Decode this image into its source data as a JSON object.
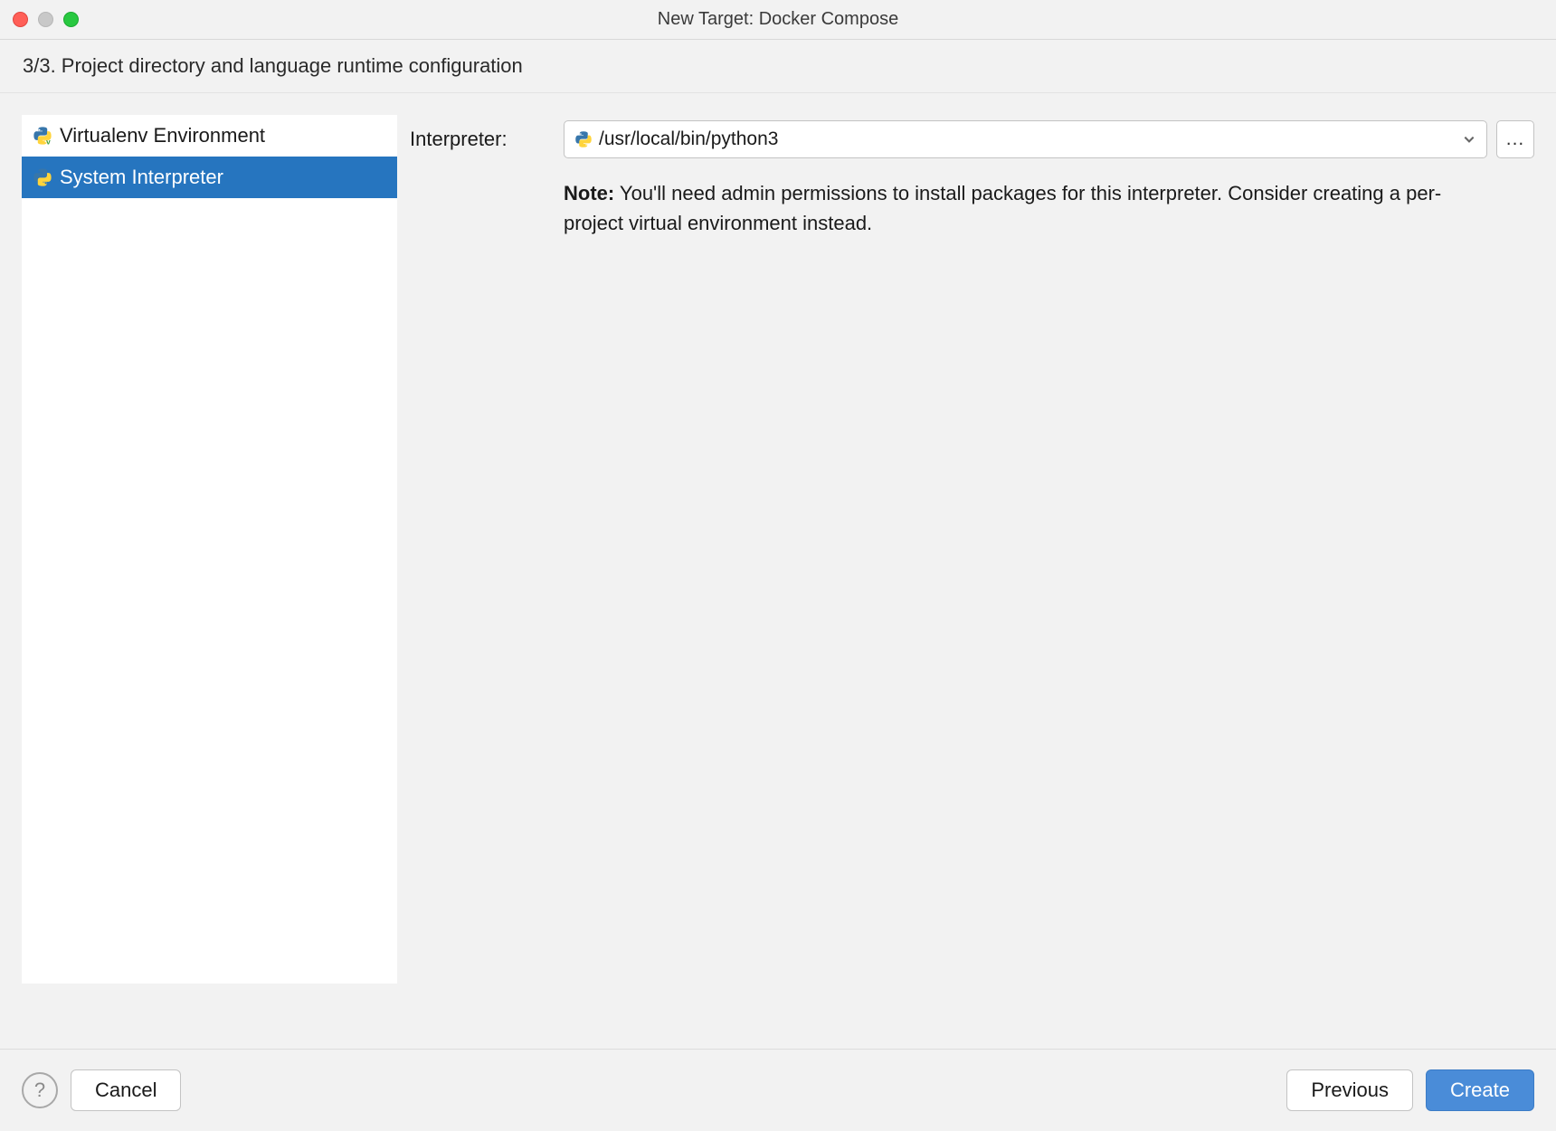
{
  "window": {
    "title": "New Target: Docker Compose"
  },
  "subtitle": "3/3. Project directory and language runtime configuration",
  "sidebar": {
    "items": [
      {
        "label": "Virtualenv Environment",
        "selected": false
      },
      {
        "label": "System Interpreter",
        "selected": true
      }
    ]
  },
  "form": {
    "interpreter_label": "Interpreter:",
    "interpreter_value": "/usr/local/bin/python3",
    "browse_label": "...",
    "note_prefix": "Note:",
    "note_text": " You'll need admin permissions to install packages for this interpreter. Consider creating a per-project virtual environment instead."
  },
  "buttons": {
    "help": "?",
    "cancel": "Cancel",
    "previous": "Previous",
    "create": "Create"
  }
}
